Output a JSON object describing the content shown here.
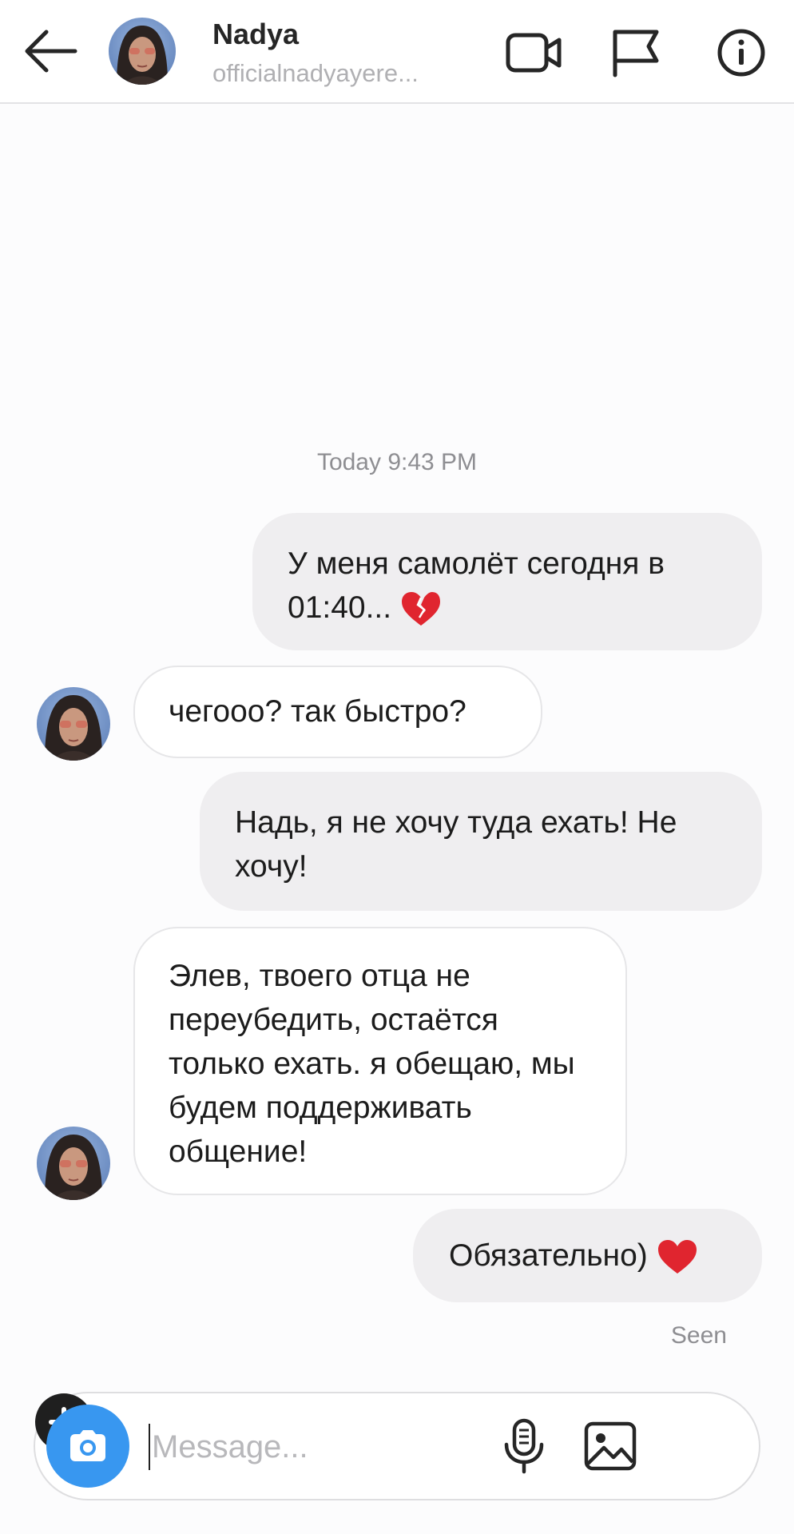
{
  "header": {
    "name": "Nadya",
    "username": "officialnadyayere..."
  },
  "conversation": {
    "timestamp": "Today 9:43 PM",
    "messages": [
      {
        "from": "me",
        "text": "У меня самолёт сегодня в 01:40...",
        "emoji": "broken-heart"
      },
      {
        "from": "them",
        "text": "чегооо? так быстро?"
      },
      {
        "from": "me",
        "text": "Надь, я не хочу туда ехать! Не хочу!"
      },
      {
        "from": "them",
        "text": "Элев, твоего отца не переубедить, остаётся только ехать. я обещаю, мы будем поддерживать общение!"
      },
      {
        "from": "me",
        "text": "Обязательно)",
        "emoji": "red-heart"
      }
    ],
    "status": "Seen"
  },
  "composer": {
    "placeholder": "Message...",
    "value": ""
  },
  "colors": {
    "accent": "#3897f0",
    "outgoing_bubble": "#efeef0",
    "incoming_border": "#e6e6e8",
    "heart": "#e0252f"
  }
}
